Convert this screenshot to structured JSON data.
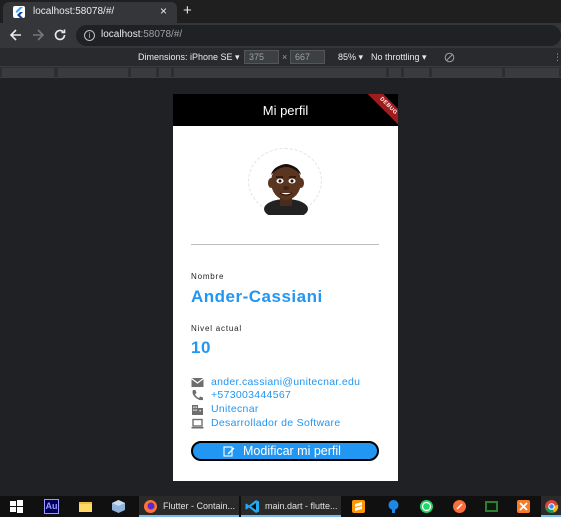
{
  "browser": {
    "tab_title": "localhost:58078/#/",
    "tab_close": "×",
    "new_tab": "+",
    "url_host": "localhost",
    "url_path": ":58078/#/"
  },
  "device_toolbar": {
    "dimensions_label": "Dimensions: iPhone SE ▾",
    "width": "375",
    "times": "×",
    "height": "667",
    "zoom": "85% ▾",
    "throttling": "No throttling ▾"
  },
  "app": {
    "title": "Mi perfil",
    "debug_banner": "DEBUG",
    "name_label": "Nombre",
    "name_value": "Ander-Cassiani",
    "level_label": "Nivel actual",
    "level_value": "10",
    "contact": [
      {
        "icon": "email-icon",
        "text": "ander.cassiani@unitecnar.edu"
      },
      {
        "icon": "phone-icon",
        "text": "+573003444567"
      },
      {
        "icon": "business-icon",
        "text": "Unitecnar"
      },
      {
        "icon": "laptop-icon",
        "text": "Desarrollador de Software"
      }
    ],
    "modify_button": "Modificar mi perfil",
    "accent_color": "#2196f3"
  },
  "taskbar": {
    "items": [
      {
        "icon": "windows-start-icon"
      },
      {
        "icon": "audition-icon",
        "text": "Au"
      },
      {
        "icon": "file-explorer-icon"
      },
      {
        "icon": "package-icon"
      },
      {
        "icon": "firefox-icon",
        "label": "Flutter - Contain..."
      },
      {
        "icon": "vscode-icon",
        "label": "main.dart - flutte..."
      },
      {
        "icon": "sublime-icon"
      },
      {
        "icon": "sourcetree-icon"
      },
      {
        "icon": "whatsapp-icon"
      },
      {
        "icon": "postman-icon"
      },
      {
        "icon": "terminal-icon"
      },
      {
        "icon": "xampp-icon"
      },
      {
        "icon": "chrome-icon"
      }
    ]
  }
}
